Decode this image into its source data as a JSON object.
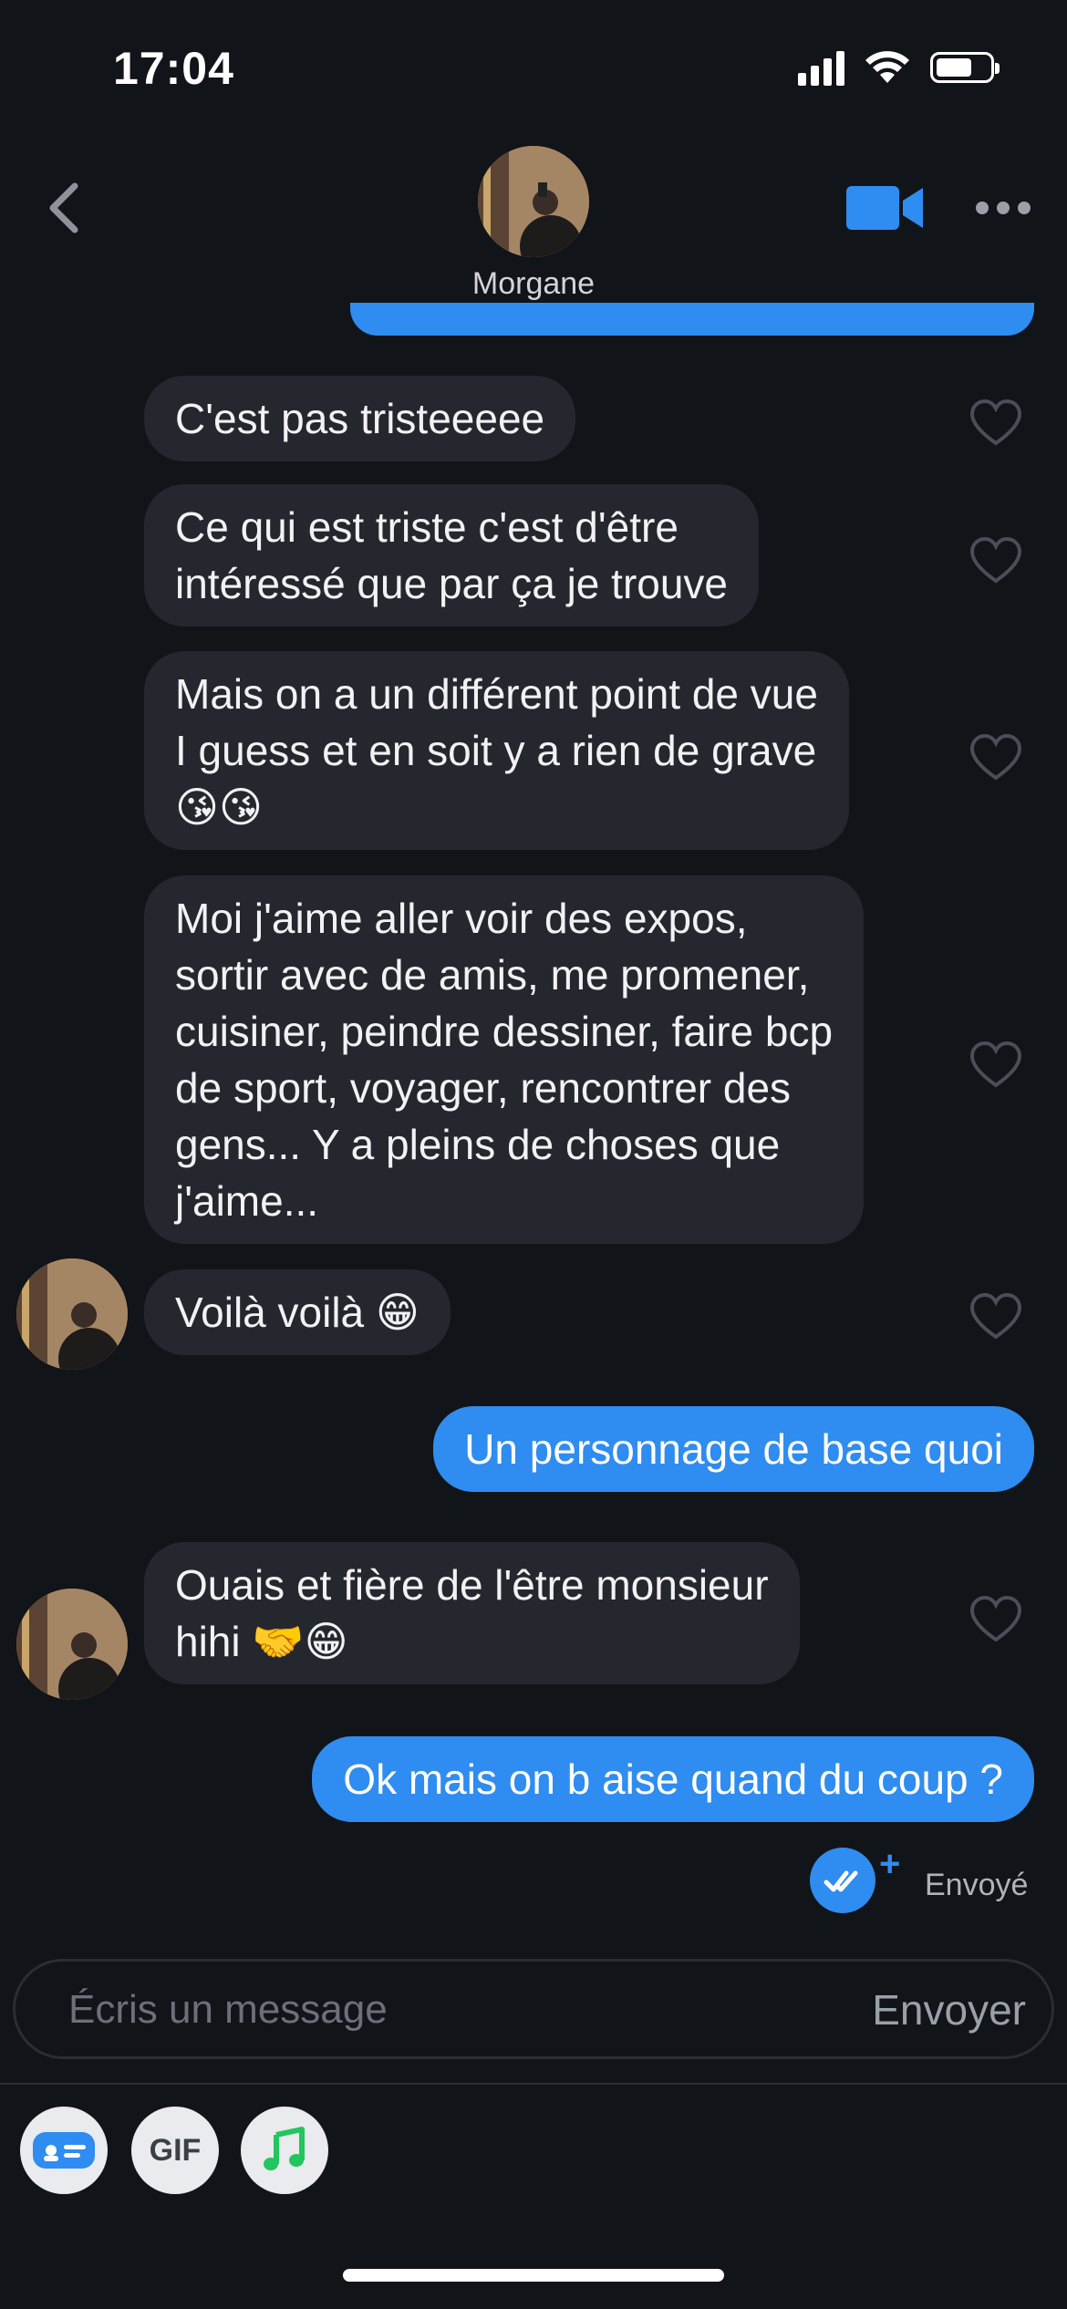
{
  "status_bar": {
    "time": "17:04"
  },
  "header": {
    "contact_name": "Morgane",
    "back_icon": "chevron-left-icon",
    "video_icon": "video-camera-icon",
    "more_icon": "more-dots-icon"
  },
  "messages": [
    {
      "direction": "received",
      "text": "C'est pas tristeeeee"
    },
    {
      "direction": "received",
      "text": "Ce qui est triste c'est d'être\nintéressé que par ça je trouve"
    },
    {
      "direction": "received",
      "text": "Mais on a un différent point de vue\nI guess et en soit y a rien de grave\n😘😘"
    },
    {
      "direction": "received",
      "text": "Moi j'aime aller voir des expos,\nsortir avec de amis, me promener,\ncuisiner, peindre dessiner, faire bcp\nde sport, voyager, rencontrer des\ngens... Y a pleins de choses que\nj'aime..."
    },
    {
      "direction": "received",
      "text": "Voilà voilà 😁"
    },
    {
      "direction": "sent",
      "text": "Un personnage de base quoi"
    },
    {
      "direction": "received",
      "text": "Ouais et fière de l'être monsieur\nhihi 🤝😁"
    },
    {
      "direction": "sent",
      "text": "Ok mais on b aise quand du coup ?"
    }
  ],
  "delivery": {
    "plus": "+",
    "status": "Envoyé"
  },
  "composer": {
    "placeholder": "Écris un message",
    "send_label": "Envoyer"
  },
  "toolbar": {
    "gif_label": "GIF"
  },
  "colors": {
    "accent": "#2f8cf0",
    "background": "#111418",
    "received_bubble": "#24272e"
  }
}
